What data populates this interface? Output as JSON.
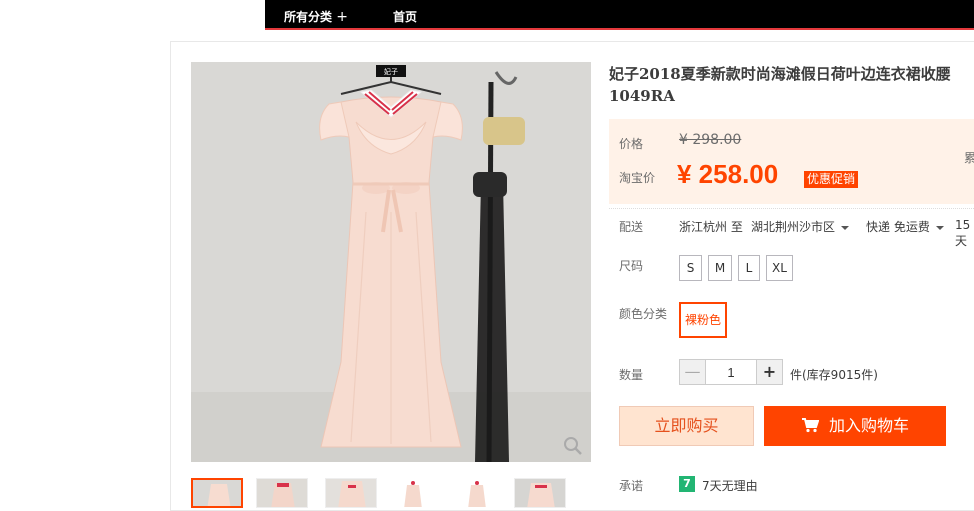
{
  "nav": {
    "all_categories": "所有分类",
    "plus": "+",
    "home": "首页"
  },
  "product": {
    "title": "妃子2018夏季新款时尚海滩假日荷叶边连衣裙收腰 1049RA",
    "brand_tag": "妃子"
  },
  "price": {
    "label": "价格",
    "original": "¥ 298.00",
    "sale_label": "淘宝价",
    "sale": "¥ 258.00",
    "promo_badge": "优惠促销",
    "accumulated": "累"
  },
  "delivery": {
    "label": "配送",
    "from": "浙江杭州 至",
    "to": "湖北荆州沙市区",
    "method": "快递 免运费",
    "extra": "15天"
  },
  "size": {
    "label": "尺码",
    "options": [
      "S",
      "M",
      "L",
      "XL"
    ]
  },
  "color": {
    "label": "颜色分类",
    "selected": "裸粉色"
  },
  "quantity": {
    "label": "数量",
    "value": "1",
    "minus": "—",
    "plus": "+",
    "stock": "件(库存9015件)"
  },
  "actions": {
    "buy_now": "立即购买",
    "add_cart": "加入购物车"
  },
  "promise": {
    "label": "承诺",
    "icon_text": "7",
    "text": "7天无理由"
  },
  "colors": {
    "accent": "#ff4400",
    "price_bg": "#fff2e8",
    "dress": "#f7dcd0"
  }
}
